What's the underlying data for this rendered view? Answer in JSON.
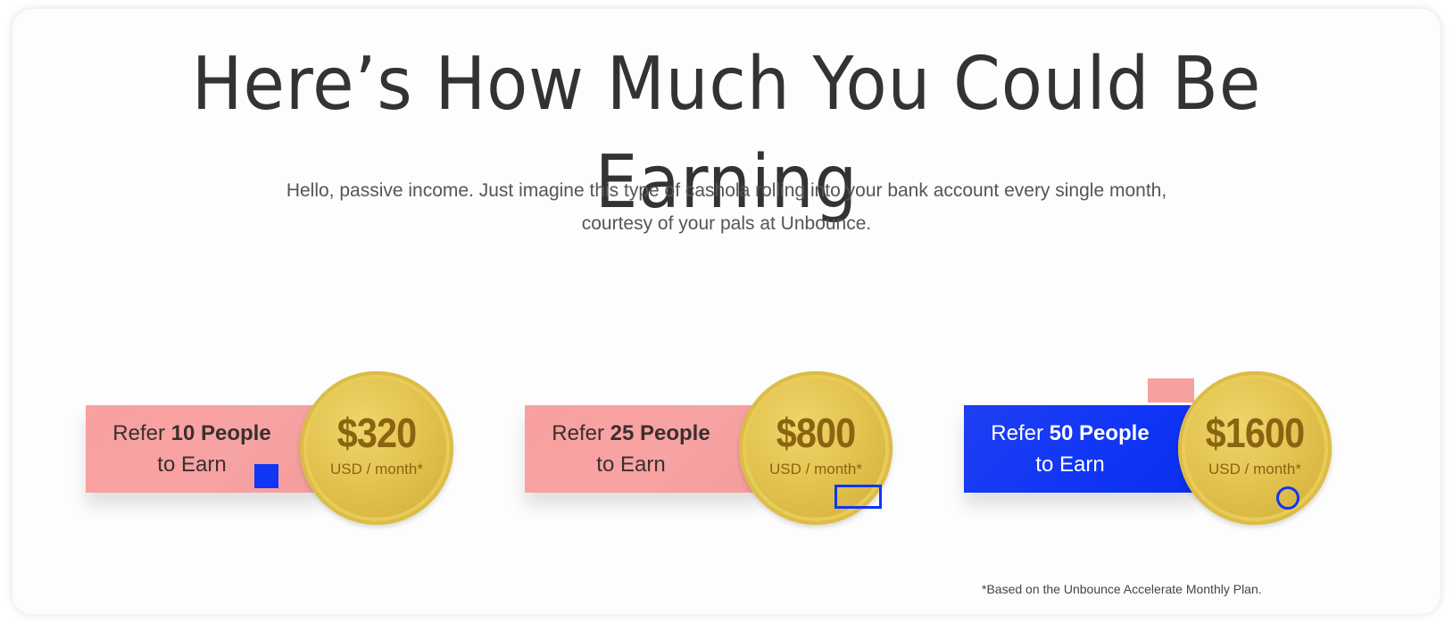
{
  "headline": "Here’s How Much You Could Be Earning",
  "subtitle": {
    "line1": "Hello, passive income. Just imagine this type of cashola rolling into your bank account every single month,",
    "line2": "courtesy of your pals at Unbounce."
  },
  "tiers": [
    {
      "refer_prefix": "Refer ",
      "refer_count": "10 People",
      "to_earn": "to Earn",
      "amount": "$320",
      "unit": "USD / month*",
      "banner_color": "#f7a3a3"
    },
    {
      "refer_prefix": "Refer ",
      "refer_count": "25 People",
      "to_earn": "to Earn",
      "amount": "$800",
      "unit": "USD / month*",
      "banner_color": "#f7a3a3"
    },
    {
      "refer_prefix": "Refer ",
      "refer_count": "50 People",
      "to_earn": "to Earn",
      "amount": "$1600",
      "unit": "USD / month*",
      "banner_color": "#1035f5"
    }
  ],
  "footnote": "*Based on the Unbounce Accelerate Monthly Plan.",
  "colors": {
    "accent_blue": "#1035f5",
    "accent_pink": "#f7a3a3",
    "coin_gold": "#e3c350",
    "text_dark": "#333333"
  }
}
